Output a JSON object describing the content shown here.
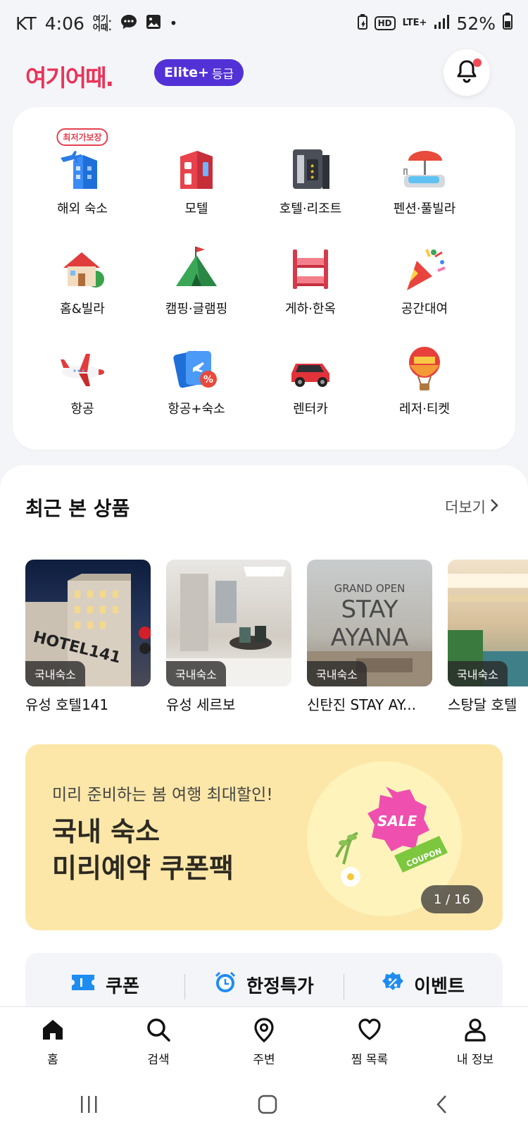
{
  "status_bar": {
    "carrier": "KT",
    "time": "4:06",
    "mini_logo": "여기.\n어때.",
    "hd": "HD",
    "lte": "LTE+",
    "battery": "52%"
  },
  "header": {
    "logo": "여기어때.",
    "grade": "Elite+",
    "grade_suffix": "등급"
  },
  "categories": [
    {
      "label": "해외 숙소",
      "badge": "최저가보장",
      "icon": "overseas-building-icon"
    },
    {
      "label": "모텔",
      "icon": "motel-icon"
    },
    {
      "label": "호텔·리조트",
      "icon": "hotel-icon"
    },
    {
      "label": "펜션·풀빌라",
      "icon": "pool-villa-icon"
    },
    {
      "label": "홈&빌라",
      "icon": "house-icon"
    },
    {
      "label": "캠핑·글램핑",
      "icon": "tent-icon"
    },
    {
      "label": "게하·한옥",
      "icon": "bunk-bed-icon"
    },
    {
      "label": "공간대여",
      "icon": "party-popper-icon"
    },
    {
      "label": "항공",
      "icon": "airplane-icon"
    },
    {
      "label": "항공+숙소",
      "icon": "ticket-discount-icon"
    },
    {
      "label": "렌터카",
      "icon": "car-icon"
    },
    {
      "label": "레저·티켓",
      "icon": "balloon-icon"
    }
  ],
  "recent": {
    "title": "최근 본 상품",
    "more": "더보기",
    "items": [
      {
        "tag": "국내숙소",
        "name": "유성 호텔141",
        "sign": "HOTEL141"
      },
      {
        "tag": "국내숙소",
        "name": "유성 세르보"
      },
      {
        "tag": "국내숙소",
        "name": "신탄진 STAY AY...",
        "line1": "GRAND OPEN",
        "line2": "STAY",
        "line3": "AYANA"
      },
      {
        "tag": "국내숙소",
        "name": "스탕달 호텔"
      }
    ]
  },
  "promo": {
    "subtitle": "미리 준비하는 봄 여행 최대할인!",
    "title_line1": "국내 숙소",
    "title_line2": "미리예약 쿠폰팩",
    "sale_text": "SALE",
    "coupon_text": "COUPON",
    "counter": "1 / 16"
  },
  "quick_links": [
    {
      "label": "쿠폰",
      "icon": "ticket-icon"
    },
    {
      "label": "한정특가",
      "icon": "alarm-clock-icon"
    },
    {
      "label": "이벤트",
      "icon": "percent-badge-icon"
    }
  ],
  "bottom_nav": [
    {
      "label": "홈",
      "icon": "home-icon"
    },
    {
      "label": "검색",
      "icon": "search-icon"
    },
    {
      "label": "주변",
      "icon": "location-pin-icon"
    },
    {
      "label": "찜 목록",
      "icon": "heart-icon"
    },
    {
      "label": "내 정보",
      "icon": "person-icon"
    }
  ],
  "colors": {
    "brand": "#ea3359",
    "grade_pill": "#5231d6",
    "quick_icon": "#1f8cf0",
    "promo_bg": "#fce7a8"
  }
}
